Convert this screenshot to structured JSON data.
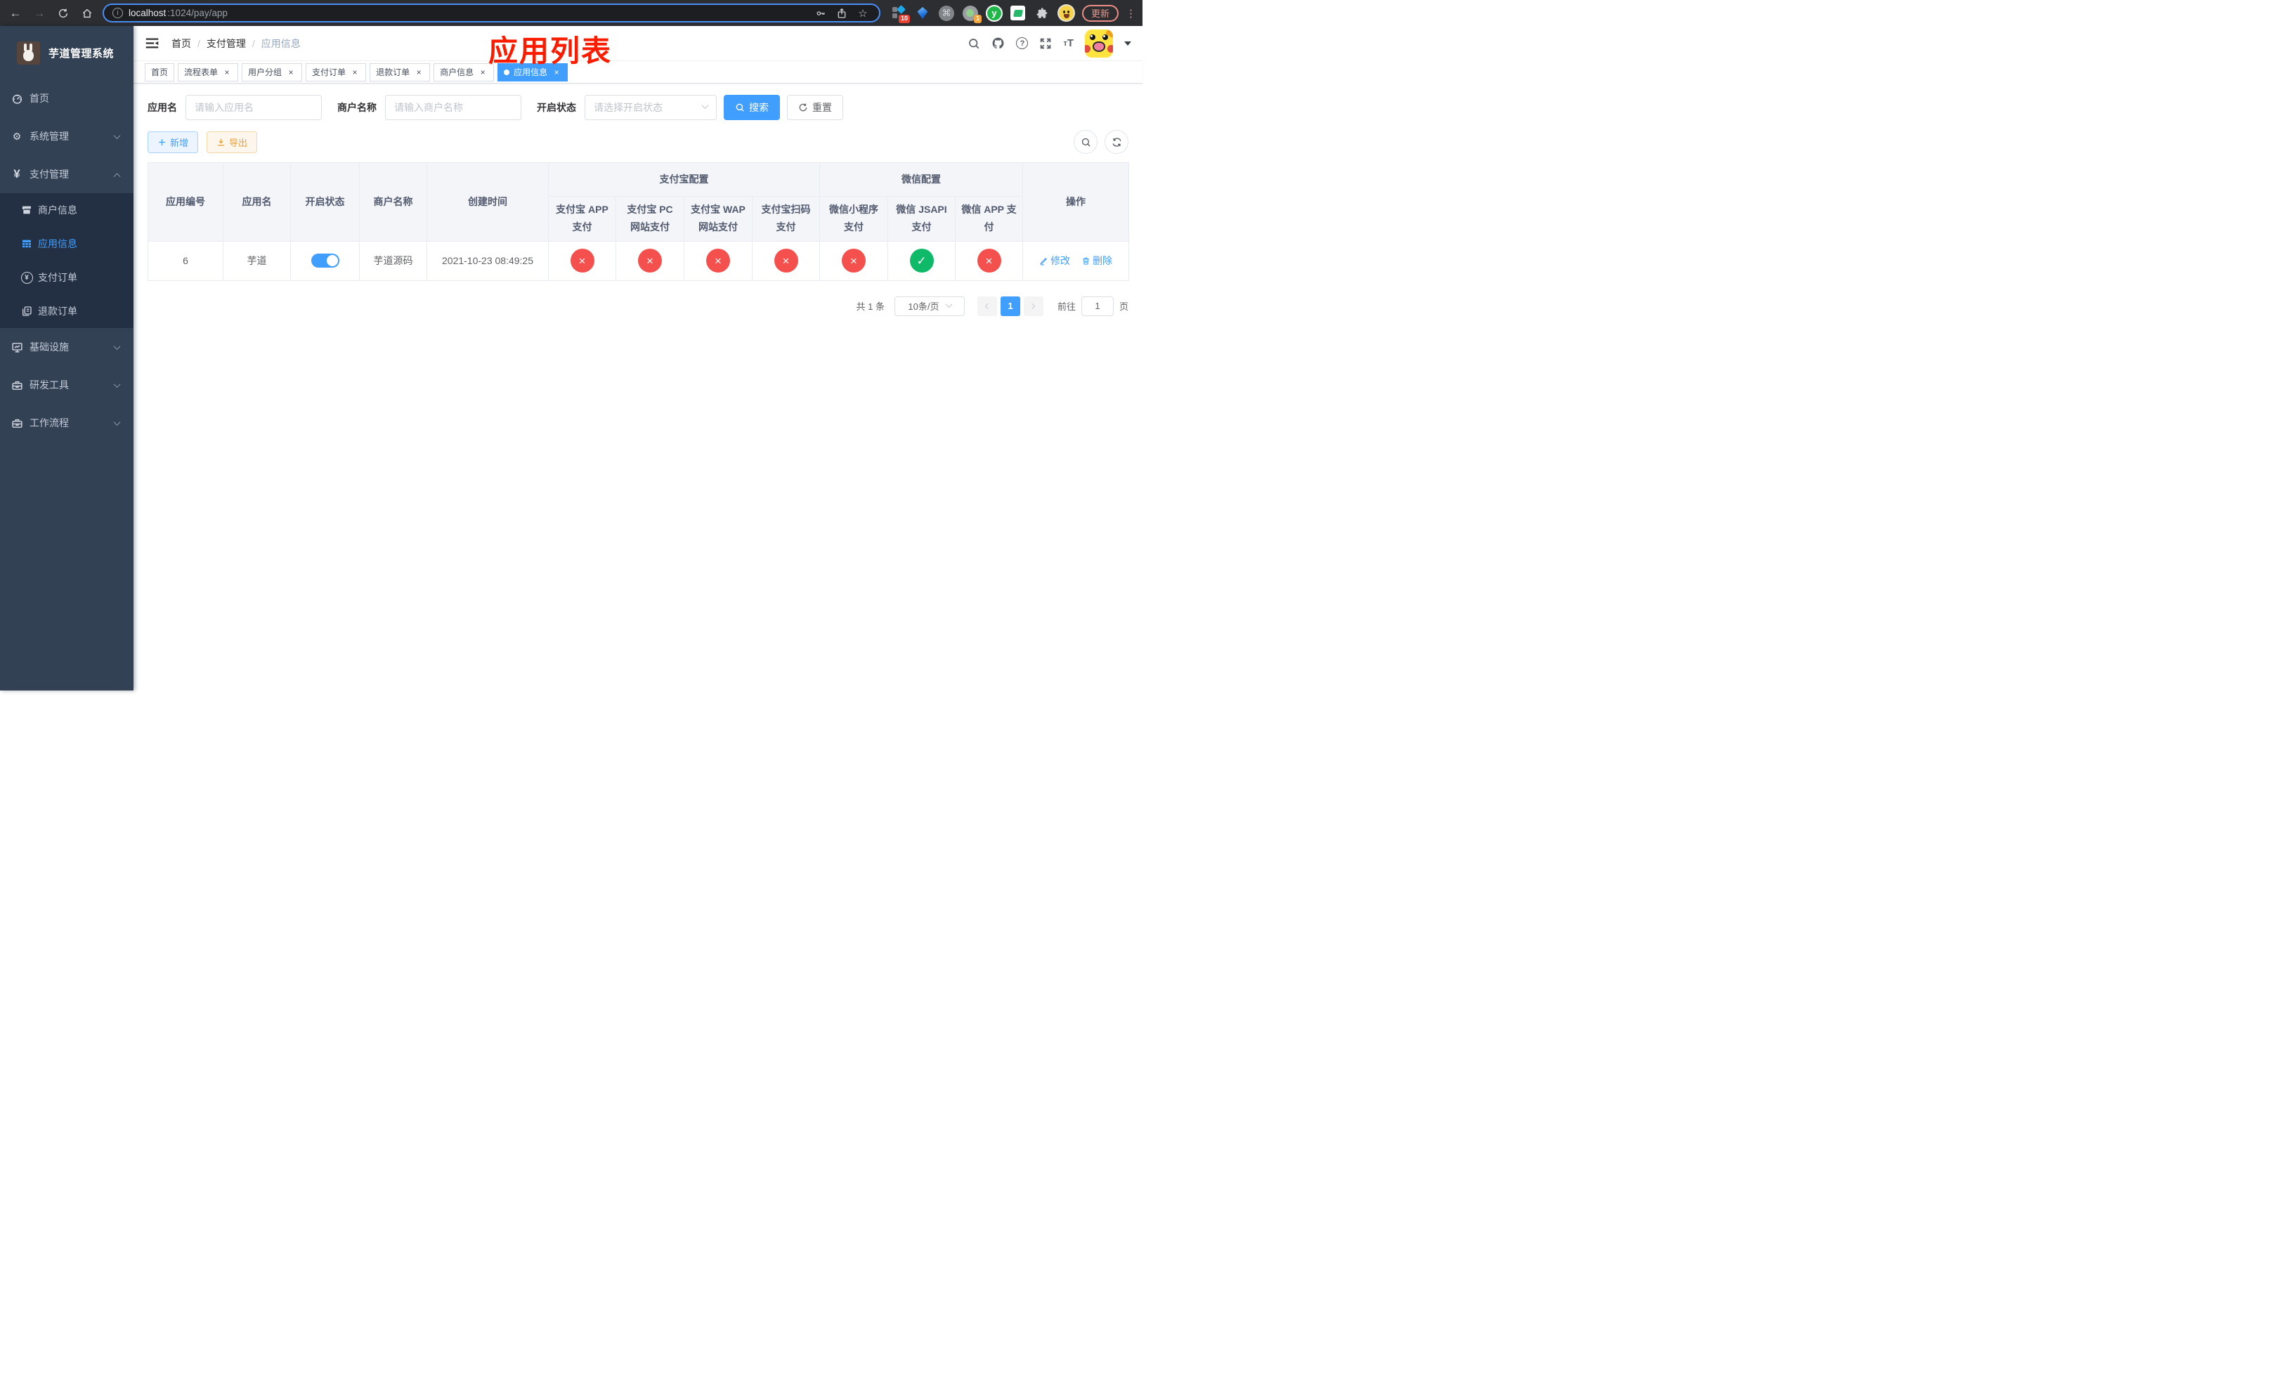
{
  "browser": {
    "url": {
      "host": "localhost",
      "path": ":1024/pay/app"
    },
    "update_label": "更新",
    "menu_dots": "⋮",
    "extensions": {
      "blocks_badge": "10",
      "screen_badge": "1",
      "yudao_letter": "y",
      "command_glyph": "⌘"
    }
  },
  "sidebar": {
    "title": "芋道管理系统",
    "items": [
      {
        "label": "首页"
      },
      {
        "label": "系统管理",
        "chevron": "down"
      },
      {
        "label": "支付管理",
        "chevron": "up"
      },
      {
        "label": "商户信息"
      },
      {
        "label": "应用信息",
        "active": "true"
      },
      {
        "label": "支付订单"
      },
      {
        "label": "退款订单"
      },
      {
        "label": "基础设施",
        "chevron": "down"
      },
      {
        "label": "研发工具",
        "chevron": "down"
      },
      {
        "label": "工作流程",
        "chevron": "down"
      }
    ]
  },
  "navbar": {
    "breadcrumb": [
      {
        "label": "首页"
      },
      {
        "label": "支付管理"
      },
      {
        "label": "应用信息"
      }
    ],
    "separator": "/",
    "font_small": "т",
    "font_big": "T"
  },
  "annotation": "应用列表",
  "tabs": [
    {
      "label": "首页"
    },
    {
      "label": "流程表单",
      "close": "×"
    },
    {
      "label": "用户分组",
      "close": "×"
    },
    {
      "label": "支付订单",
      "close": "×"
    },
    {
      "label": "退款订单",
      "close": "×"
    },
    {
      "label": "商户信息",
      "close": "×"
    },
    {
      "label": "应用信息",
      "close": "×",
      "active": "true"
    }
  ],
  "filters": {
    "app_name": {
      "label": "应用名",
      "placeholder": "请输入应用名"
    },
    "merchant_name": {
      "label": "商户名称",
      "placeholder": "请输入商户名称"
    },
    "status": {
      "label": "开启状态",
      "placeholder": "请选择开启状态"
    },
    "search_label": "搜索",
    "reset_label": "重置"
  },
  "toolbar": {
    "add_label": "新增",
    "export_label": "导出"
  },
  "table": {
    "columns": [
      "应用编号",
      "应用名",
      "开启状态",
      "商户名称",
      "创建时间"
    ],
    "groups": [
      {
        "label": "支付宝配置"
      },
      {
        "label": "微信配置"
      }
    ],
    "pay_columns": [
      "支付宝 APP 支付",
      "支付宝 PC 网站支付",
      "支付宝 WAP 网站支付",
      "支付宝扫码支付",
      "微信小程序支付",
      "微信 JSAPI 支付",
      "微信 APP 支付"
    ],
    "op_column": "操作",
    "row": {
      "id": "6",
      "name": "芋道",
      "enabled": "on",
      "merchant": "芋道源码",
      "created": "2021-10-23 08:49:25",
      "statuses": [
        {
          "state": "off",
          "glyph": "×"
        },
        {
          "state": "off",
          "glyph": "×"
        },
        {
          "state": "off",
          "glyph": "×"
        },
        {
          "state": "off",
          "glyph": "×"
        },
        {
          "state": "off",
          "glyph": "×"
        },
        {
          "state": "on",
          "glyph": "✓"
        },
        {
          "state": "off",
          "glyph": "×"
        }
      ],
      "edit_label": "修改",
      "delete_label": "删除"
    }
  },
  "pagination": {
    "total": "共 1 条",
    "page_size": "10条/页",
    "current_page": "1",
    "goto_label": "前往",
    "goto_value": "1",
    "page_unit": "页"
  },
  "colors": {
    "accent": "#409eff",
    "danger": "#f4504d",
    "success": "#0eb968",
    "warning": "#e6a23c",
    "sidebar": "#334154"
  }
}
